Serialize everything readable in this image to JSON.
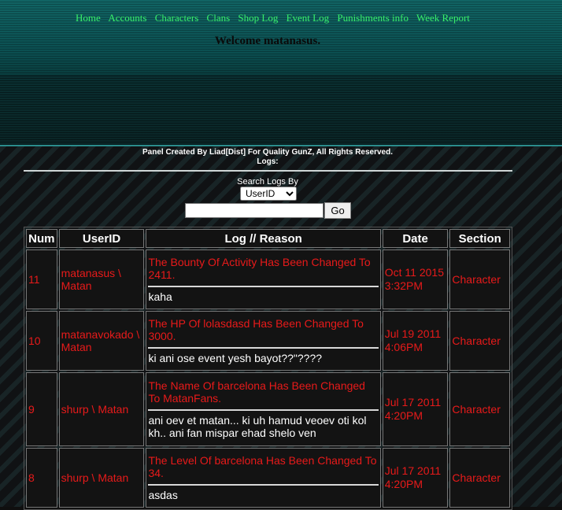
{
  "nav": {
    "items": [
      "Home",
      "Accounts",
      "Characters",
      "Clans",
      "Shop Log",
      "Event Log",
      "Punishments info",
      "Week Report"
    ]
  },
  "welcome": "Welcome matanasus.",
  "credits": {
    "line1": "Panel Created By Liad[Dist] For Quality GunZ, All Rights Reserved.",
    "line2": "Logs:"
  },
  "search": {
    "label": "Search Logs By",
    "selected": "UserID",
    "go": "Go",
    "value": ""
  },
  "table": {
    "headers": [
      "Num",
      "UserID",
      "Log // Reason",
      "Date",
      "Section"
    ],
    "rows": [
      {
        "num": "11",
        "user": "matanasus \\ Matan",
        "log": "The Bounty Of Activity Has Been Changed To 2411.",
        "reason": "kaha",
        "date": "Oct 11 2015 3:32PM",
        "section": "Character"
      },
      {
        "num": "10",
        "user": "matanavokado \\ Matan",
        "log": "The HP Of lolasdasd Has Been Changed To 3000.",
        "reason": "ki ani ose event yesh bayot??\"????",
        "date": "Jul 19 2011 4:06PM",
        "section": "Character"
      },
      {
        "num": "9",
        "user": "shurp \\ Matan",
        "log": "The Name Of barcelona Has Been Changed To MatanFans.",
        "reason": "ani oev et matan... ki uh hamud veoev oti kol kh.. ani fan mispar ehad shelo ven",
        "date": "Jul 17 2011 4:20PM",
        "section": "Character"
      },
      {
        "num": "8",
        "user": "shurp \\ Matan",
        "log": "The Level Of barcelona Has Been Changed To 34.",
        "reason": "asdas",
        "date": "Jul 17 2011 4:20PM",
        "section": "Character"
      }
    ]
  },
  "colors": {
    "nav_link": "#38f06a",
    "table_text": "#e81a1a",
    "header_teal": "#0c4747"
  }
}
